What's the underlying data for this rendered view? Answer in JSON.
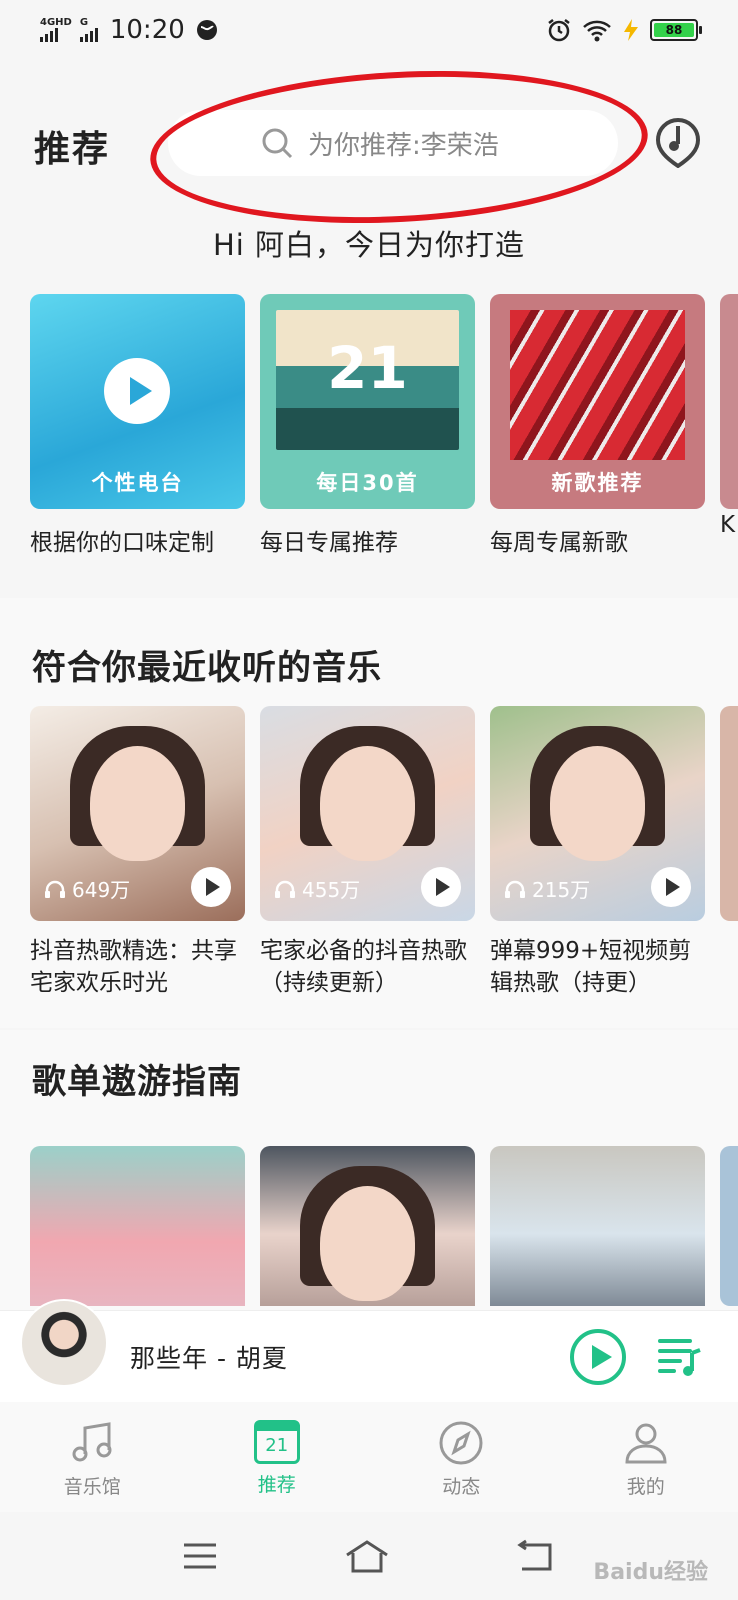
{
  "status_bar": {
    "network_1": "4GHD",
    "network_2": "G",
    "time": "10:20",
    "battery": "88"
  },
  "header": {
    "title": "推荐",
    "search_placeholder": "为你推荐:李荣浩"
  },
  "greeting": "Hi 阿白，今日为你打造",
  "top_cards": [
    {
      "cover_label": "个性电台",
      "caption": "根据你的口味定制"
    },
    {
      "cover_label": "每日30首",
      "cover_number": "21",
      "caption": "每日专属推荐"
    },
    {
      "cover_label": "新歌推荐",
      "caption": "每周专属新歌"
    }
  ],
  "top_cards_peek_caption": "K",
  "recent_section": {
    "title": "符合你最近收听的音乐",
    "cards": [
      {
        "plays": "649万",
        "caption": "抖音热歌精选：共享宅家欢乐时光"
      },
      {
        "plays": "455万",
        "caption": "宅家必备的抖音热歌（持续更新）"
      },
      {
        "plays": "215万",
        "caption": "弹幕999+短视频剪辑热歌（持更）"
      }
    ]
  },
  "playlist_section": {
    "title": "歌单遨游指南"
  },
  "player": {
    "now_playing": "那些年 - 胡夏"
  },
  "tabs": [
    {
      "label": "音乐馆",
      "icon": "music-note-icon"
    },
    {
      "label": "推荐",
      "icon": "calendar-icon",
      "number": "21"
    },
    {
      "label": "动态",
      "icon": "compass-icon"
    },
    {
      "label": "我的",
      "icon": "person-icon"
    }
  ],
  "active_tab": "推荐",
  "watermark": "Baidu经验",
  "colors": {
    "accent": "#22c188",
    "annotation": "#e0171f",
    "background": "#f6f6f6"
  }
}
